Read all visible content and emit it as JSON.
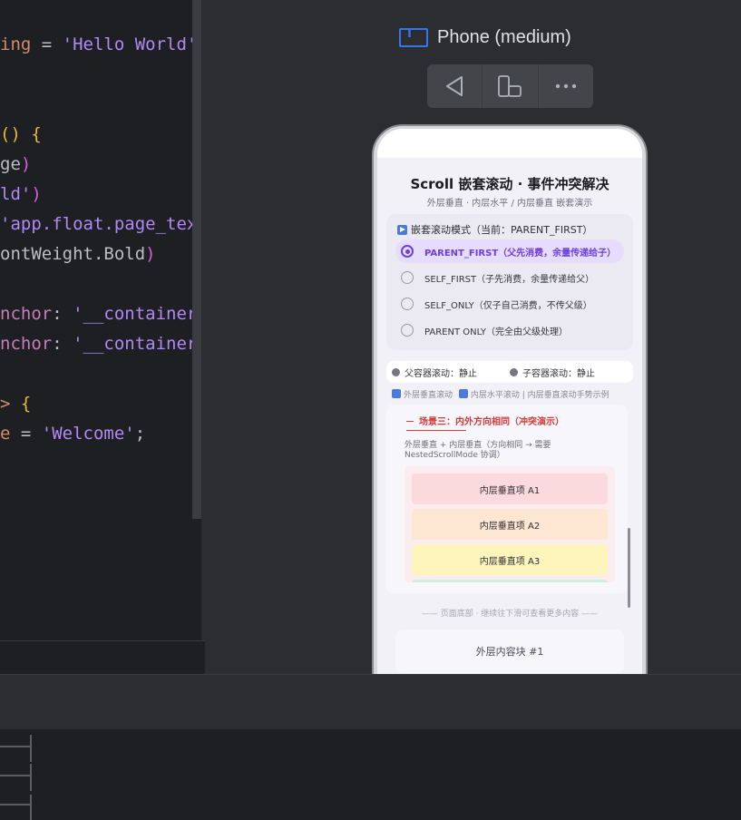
{
  "editor": {
    "lines": [
      [
        {
          "t": "ing",
          "c": "tok-orange"
        },
        {
          "t": " = ",
          "c": "tok-plain"
        },
        {
          "t": "'Hello World'",
          "c": "tok-str"
        }
      ],
      [],
      [],
      [
        {
          "t": "() ",
          "c": "tok-bracket"
        },
        {
          "t": "{",
          "c": "tok-bracket"
        }
      ],
      [
        {
          "t": "ge",
          "c": "tok-plain"
        },
        {
          "t": ")",
          "c": "tok-paren2"
        }
      ],
      [
        {
          "t": "ld'",
          "c": "tok-str"
        },
        {
          "t": ")",
          "c": "tok-paren2"
        }
      ],
      [
        {
          "t": "'app.float.page_tex",
          "c": "tok-str"
        }
      ],
      [
        {
          "t": "ontWeight.Bold",
          "c": "tok-plain"
        },
        {
          "t": ")",
          "c": "tok-paren2"
        }
      ],
      [],
      [
        {
          "t": "nchor",
          "c": "tok-green"
        },
        {
          "t": ": ",
          "c": "tok-plain"
        },
        {
          "t": "'__container",
          "c": "tok-str"
        }
      ],
      [
        {
          "t": "nchor",
          "c": "tok-green"
        },
        {
          "t": ": ",
          "c": "tok-plain"
        },
        {
          "t": "'__container",
          "c": "tok-str"
        }
      ],
      [],
      [
        {
          "t": "> ",
          "c": "tok-orange"
        },
        {
          "t": "{",
          "c": "tok-bracket"
        }
      ],
      [
        {
          "t": "e",
          "c": "tok-orange"
        },
        {
          "t": " = ",
          "c": "tok-plain"
        },
        {
          "t": "'Welcome'",
          "c": "tok-str"
        },
        {
          "t": ";",
          "c": "tok-plain"
        }
      ]
    ]
  },
  "preview": {
    "title": "Phone (medium)",
    "title_icon_glyph": "T",
    "toolbar": [
      "back-icon",
      "device-rotate-icon",
      "more-icon"
    ]
  },
  "app": {
    "title": "Scroll 嵌套滚动 · 事件冲突解决",
    "subtitle": "外层垂直 · 内层水平 / 内层垂直 嵌套演示",
    "mode_label": "嵌套滚动模式（当前：PARENT_FIRST）",
    "modes": [
      {
        "label": "PARENT_FIRST（父先消费，余量传递给子）",
        "selected": true
      },
      {
        "label": "SELF_FIRST（子先消费，余量传递给父）",
        "selected": false
      },
      {
        "label": "SELF_ONLY（仅子自己消费，不传父级）",
        "selected": false
      },
      {
        "label": "PARENT ONLY（完全由父级处理）",
        "selected": false
      }
    ],
    "status": {
      "parent": "父容器滚动：静止",
      "child": "子容器滚动：静止"
    },
    "hint_vertical": "外层垂直滚动",
    "hint_horizontal": "内层水平滚动",
    "hint_rest": "| 内层垂直滚动手势示例",
    "scene": {
      "title": "场景三：内外方向相同（冲突演示）",
      "desc": "外层垂直 + 内层垂直（方向相同 → 需要 NestedScrollMode 协调）",
      "items": [
        {
          "label": "内层垂直项 A1",
          "color": "#fadadd"
        },
        {
          "label": "内层垂直项 A2",
          "color": "#fde6d2"
        },
        {
          "label": "内层垂直项 A3",
          "color": "#fdf5bc"
        },
        {
          "label": "",
          "color": "#c9f2e2"
        }
      ]
    },
    "footer": "—— 页面底部 · 继续往下滑可查看更多内容 ——",
    "outer_card": "外层内容块 #1"
  },
  "colors": {
    "accent": "#6d3fe0",
    "ide_blue": "#3574f0",
    "danger": "#d23c3c"
  }
}
